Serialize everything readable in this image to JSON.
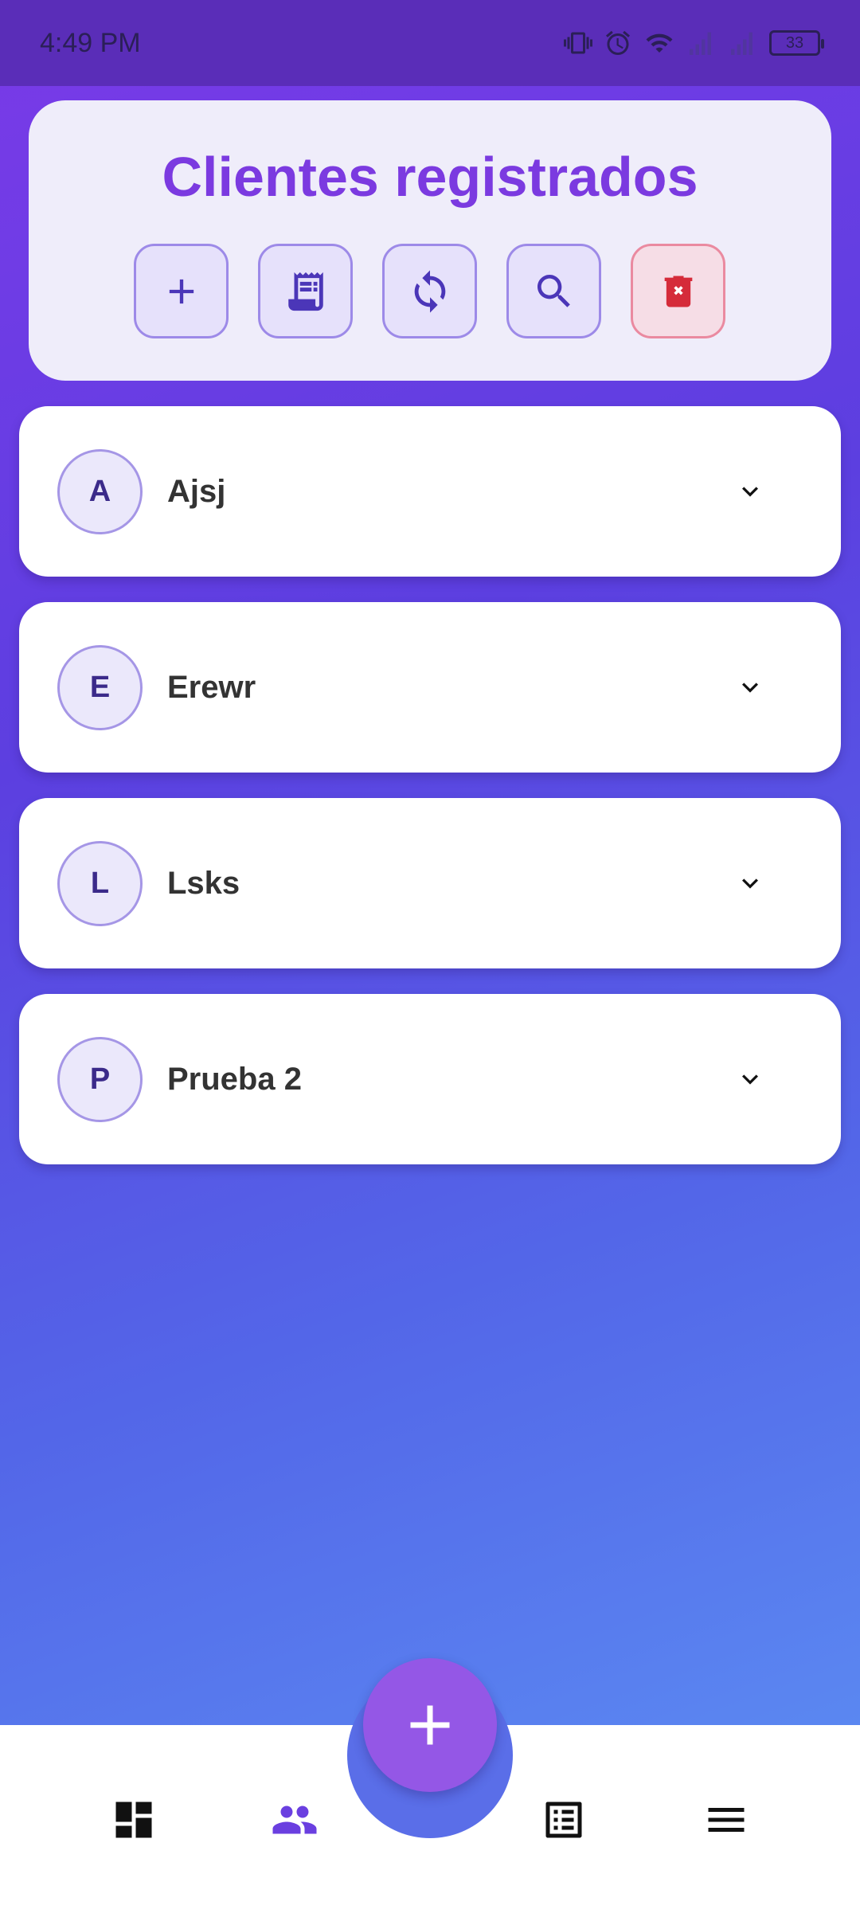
{
  "status_bar": {
    "time": "4:49 PM",
    "battery": "33"
  },
  "header": {
    "title": "Clientes registrados",
    "actions": [
      {
        "icon": "plus-icon",
        "color": "#4b36b8"
      },
      {
        "icon": "receipt-icon",
        "color": "#4b36b8"
      },
      {
        "icon": "sync-icon",
        "color": "#4b36b8"
      },
      {
        "icon": "search-icon",
        "color": "#4b36b8"
      },
      {
        "icon": "delete-icon",
        "color": "#d52b3a"
      }
    ]
  },
  "clients": [
    {
      "initial": "A",
      "name": "Ajsj"
    },
    {
      "initial": "E",
      "name": "Erewr"
    },
    {
      "initial": "L",
      "name": "Lsks"
    },
    {
      "initial": "P",
      "name": "Prueba 2"
    }
  ],
  "bottom_nav": {
    "items": [
      {
        "icon": "dashboard-icon",
        "active": false
      },
      {
        "icon": "people-icon",
        "active": true
      },
      {
        "icon": "list-icon",
        "active": false
      },
      {
        "icon": "menu-icon",
        "active": false
      }
    ],
    "fab_icon": "plus-icon"
  },
  "colors": {
    "accent": "#7b3ae0",
    "active_nav": "#6a3fe0",
    "danger": "#d52b3a"
  }
}
